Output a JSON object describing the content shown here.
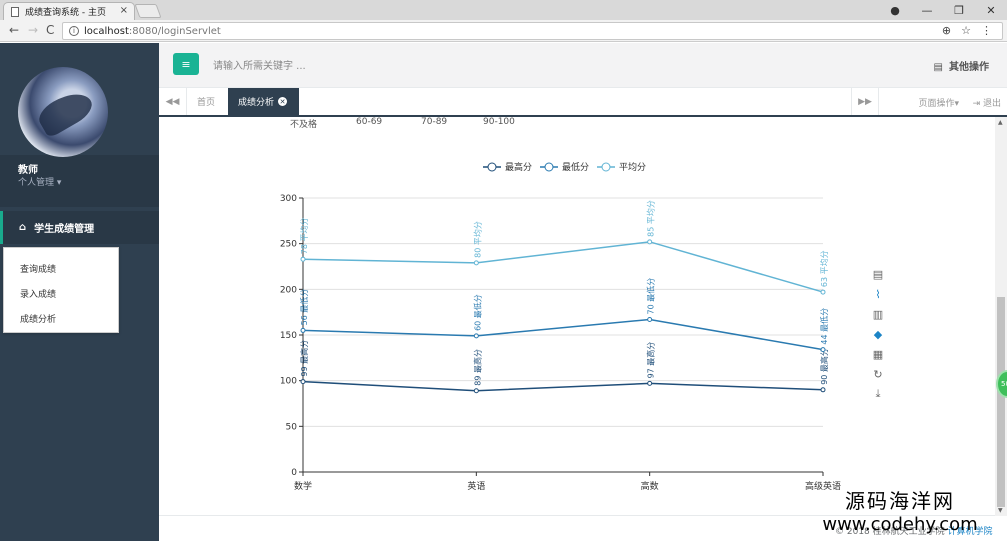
{
  "browser": {
    "tab_title": "成绩查询系统 - 主页",
    "tab_close": "×",
    "url_host": "localhost",
    "url_rest": ":8080/loginServlet",
    "nav_back": "←",
    "nav_forward": "→",
    "nav_reload": "C",
    "zoom_icon": "⊕",
    "star_icon": "☆",
    "menu_icon": "⋮",
    "win_user": "●",
    "win_min": "—",
    "win_max": "❐",
    "win_close": "✕"
  },
  "sidebar": {
    "role": "教师",
    "manage_label": "个人管理 ▾",
    "main_menu": "学生成绩管理",
    "submenu": [
      "查询成绩",
      "录入成绩",
      "成绩分析"
    ]
  },
  "header": {
    "search_placeholder": "请输入所需关键字 ...",
    "other_ops": "其他操作"
  },
  "tabs": {
    "home": "首页",
    "active": "成绩分析",
    "page_ops": "页面操作▾",
    "logout": "退出"
  },
  "content": {
    "ranges": [
      "不及格",
      "60-69",
      "70-89",
      "90-100"
    ]
  },
  "chart_data": {
    "type": "line",
    "categories": [
      "数学",
      "英语",
      "高数",
      "高级英语"
    ],
    "series": [
      {
        "name": "最高分",
        "values": [
          99,
          89,
          97,
          90
        ],
        "color": "#1f4e79",
        "label_prefix": "最高分"
      },
      {
        "name": "最低分",
        "values": [
          56,
          60,
          70,
          44
        ],
        "color": "#2a7ab0",
        "label_prefix": "最低分"
      },
      {
        "name": "平均分",
        "values": [
          78,
          80,
          85,
          63
        ],
        "color": "#61b4d4",
        "label_prefix": "平均分"
      }
    ],
    "stacked": true,
    "yticks": [
      0,
      50,
      100,
      150,
      200,
      250,
      300
    ],
    "ylim": [
      0,
      300
    ],
    "legend": "top-center"
  },
  "toolbox_icons": [
    "data-view-icon",
    "line-chart-icon",
    "bar-chart-icon",
    "stack-icon",
    "tiled-icon",
    "restore-icon",
    "download-icon"
  ],
  "footer": {
    "text": "© 2018 桂林航天工业学院 ",
    "link": "计算机学院"
  },
  "badge": {
    "text": "50"
  },
  "watermark": {
    "line1": "源码海洋网",
    "line2": "www.codehy.com"
  }
}
